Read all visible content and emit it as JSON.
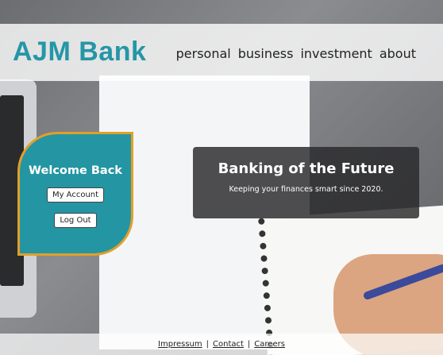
{
  "brand": {
    "name": "AJM Bank",
    "accent": "#2596a6"
  },
  "nav": [
    "personal",
    "business",
    "investment",
    "about"
  ],
  "welcome": {
    "title": "Welcome Back",
    "account_label": "My Account",
    "logout_label": "Log Out",
    "bg_color": "#2495a3",
    "border_color": "#e0a02a"
  },
  "hero": {
    "title": "Banking of the Future",
    "subtitle": "Keeping your finances smart since 2020."
  },
  "footer": {
    "links": [
      "Impressum",
      "Contact",
      "Careers"
    ],
    "separator": "|"
  }
}
